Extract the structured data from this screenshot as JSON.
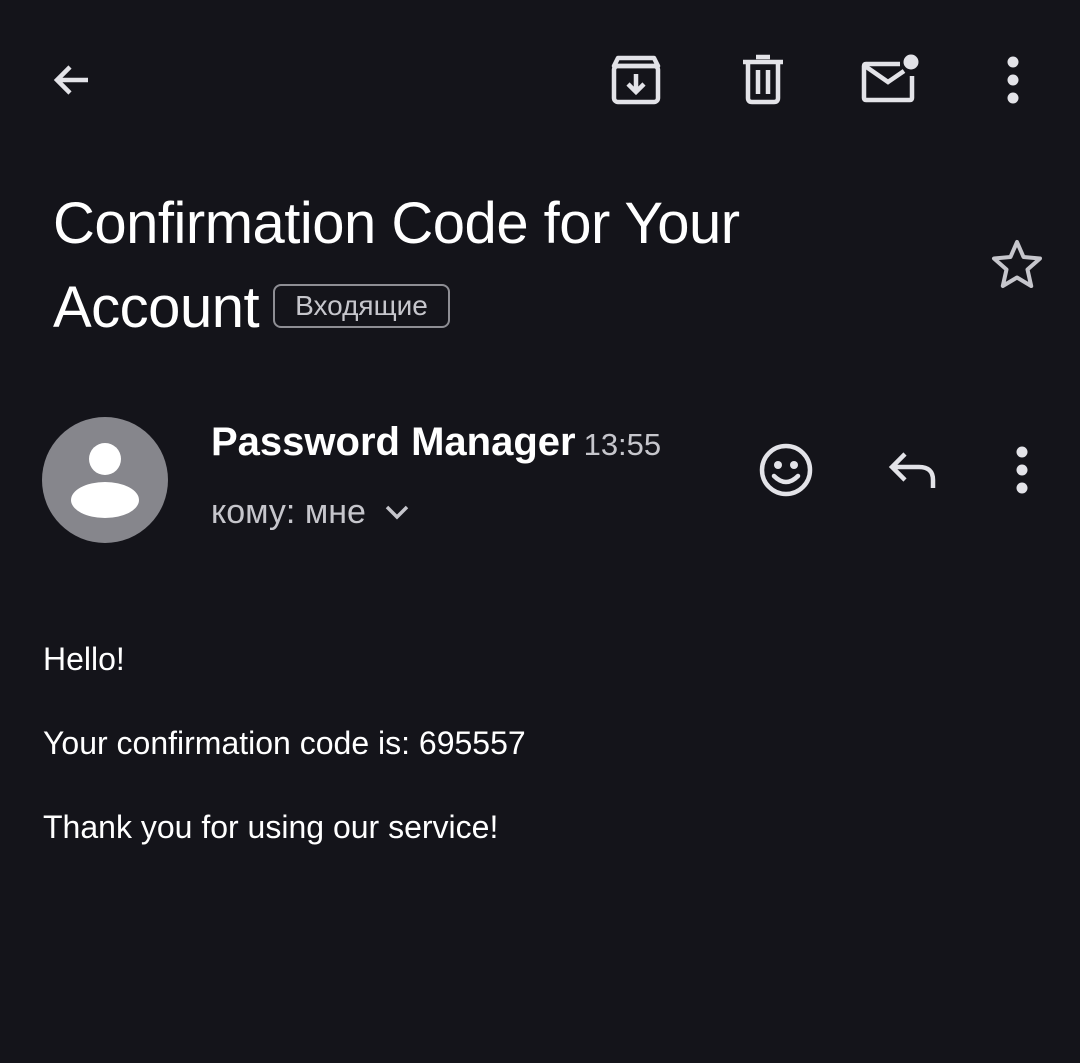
{
  "toolbar": {
    "back_icon": "arrow-left-icon",
    "archive_icon": "archive-icon",
    "delete_icon": "trash-icon",
    "unread_icon": "mail-unread-icon",
    "more_icon": "more-vert-icon"
  },
  "email": {
    "subject": "Confirmation Code for Your Account",
    "label": "Входящие",
    "star_icon": "star-outline-icon",
    "sender": {
      "name": "Password Manager",
      "time": "13:55",
      "recipient": "кому: мне",
      "avatar_icon": "person-icon"
    },
    "actions": {
      "emoji_icon": "emoji-icon",
      "reply_icon": "reply-icon",
      "more_icon": "more-vert-icon"
    },
    "body": {
      "line1": "Hello!",
      "line2": "Your confirmation code is: 695557",
      "line3": "Thank you for using our service!"
    }
  },
  "colors": {
    "background": "#14141a",
    "icon": "#e3e3e8",
    "secondary_text": "#c6c6cc",
    "avatar": "#86868c"
  }
}
